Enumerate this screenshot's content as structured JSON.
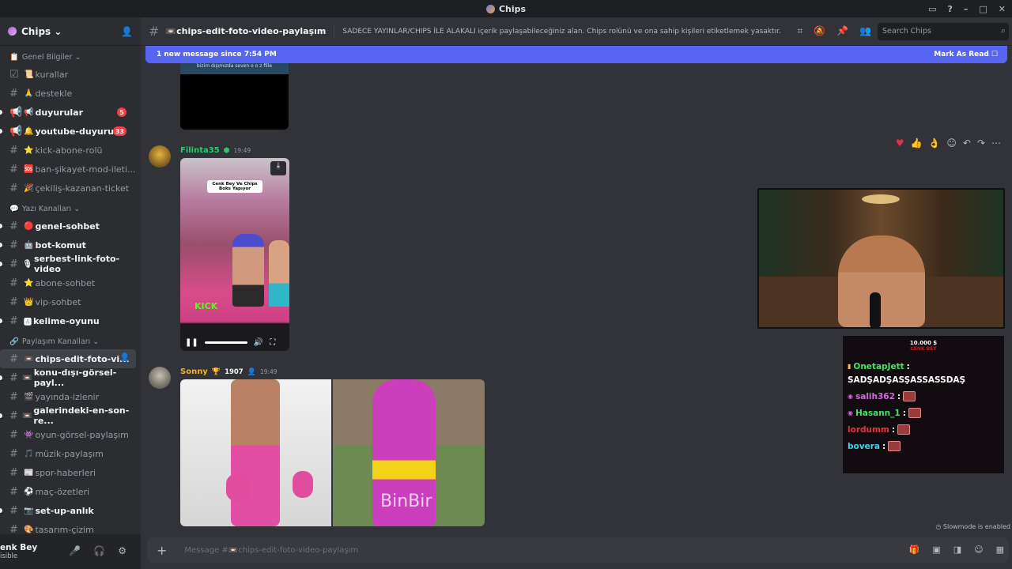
{
  "window": {
    "title": "Chips",
    "controls": [
      "▭",
      "?",
      "–",
      "□",
      "✕"
    ]
  },
  "server": {
    "name": "Chips ⌄"
  },
  "categories": {
    "genel": "Genel Bilgiler ⌄",
    "yazi": "Yazı Kanalları ⌄",
    "paylasim": "Paylaşım Kanalları ⌄"
  },
  "channels": {
    "kurallar": "kurallar",
    "destekle": "destekle",
    "duyurular": "duyurular",
    "duyurular_badge": "5",
    "youtube": "youtube-duyuru",
    "youtube_badge": "33",
    "kick": "kick-abone-rolü",
    "ban": "ban-şikayet-mod-ileti...",
    "cekilis": "çekiliş-kazanan-ticket",
    "genel": "genel-sohbet",
    "bot": "bot-komut",
    "serbest": "serbest-link-foto-video",
    "abone": "abone-sohbet",
    "vip": "vip-sohbet",
    "kelime": "kelime-oyunu",
    "chips_edit": "chips-edit-foto-vi...",
    "konu": "konu-dışı-görsel-payl...",
    "yayinda": "yayında-izlenir",
    "galeri": "galerindeki-en-son-re...",
    "oyun": "oyun-görsel-paylaşım",
    "muzik": "müzik-paylaşım",
    "spor": "spor-haberleri",
    "mac": "maç-özetleri",
    "setup": "set-up-anlık",
    "tasarim": "tasarım-çizim"
  },
  "user": {
    "name": "enk Bey",
    "status": "isible"
  },
  "header": {
    "channel": "chips-edit-foto-video-paylaşım",
    "topic": "SADECE YAYINLAR/CHIPS İLE ALAKALI içerik paylaşabileceğiniz alan. Chips rolünü ve ona sahip kişileri etiketlemek yasaktır.",
    "search_placeholder": "Search Chips"
  },
  "new_messages": {
    "text": "1 new message since 7:54 PM",
    "mark": "Mark As Read"
  },
  "messages": [
    {
      "author": "Filinta35",
      "time": "19:49",
      "color": "#2dc770",
      "video_caption": "Cenk Bey Ve Chips Boks Yapıyor",
      "top_caption": "bizim dışımızda seven o o z fille",
      "kick_label": "KICK"
    },
    {
      "author": "Sonny",
      "badge": "1907",
      "time": "19:49",
      "color": "#f0b132",
      "image_watermark": "BinBir"
    }
  ],
  "composer": {
    "placeholder": "Message #📼chips-edit-foto-video-paylaşım"
  },
  "slowmode": "Slowmode is enabled",
  "stream_overlay": {
    "goal_amount": "10.000 $",
    "goal_name": "CENK BEY",
    "chat": [
      {
        "user": "OnetapJett",
        "color": "#43e660",
        "text": "SADŞADŞASŞASSASSDAŞ"
      },
      {
        "user": "salih362",
        "color": "#d36adf",
        "emote": true
      },
      {
        "user": "Hasann_1",
        "color": "#43e660",
        "emote": true
      },
      {
        "user": "lordumm",
        "color": "#e5343e",
        "emote": true
      },
      {
        "user": "bovera",
        "color": "#45d1f0",
        "emote": true
      }
    ]
  }
}
